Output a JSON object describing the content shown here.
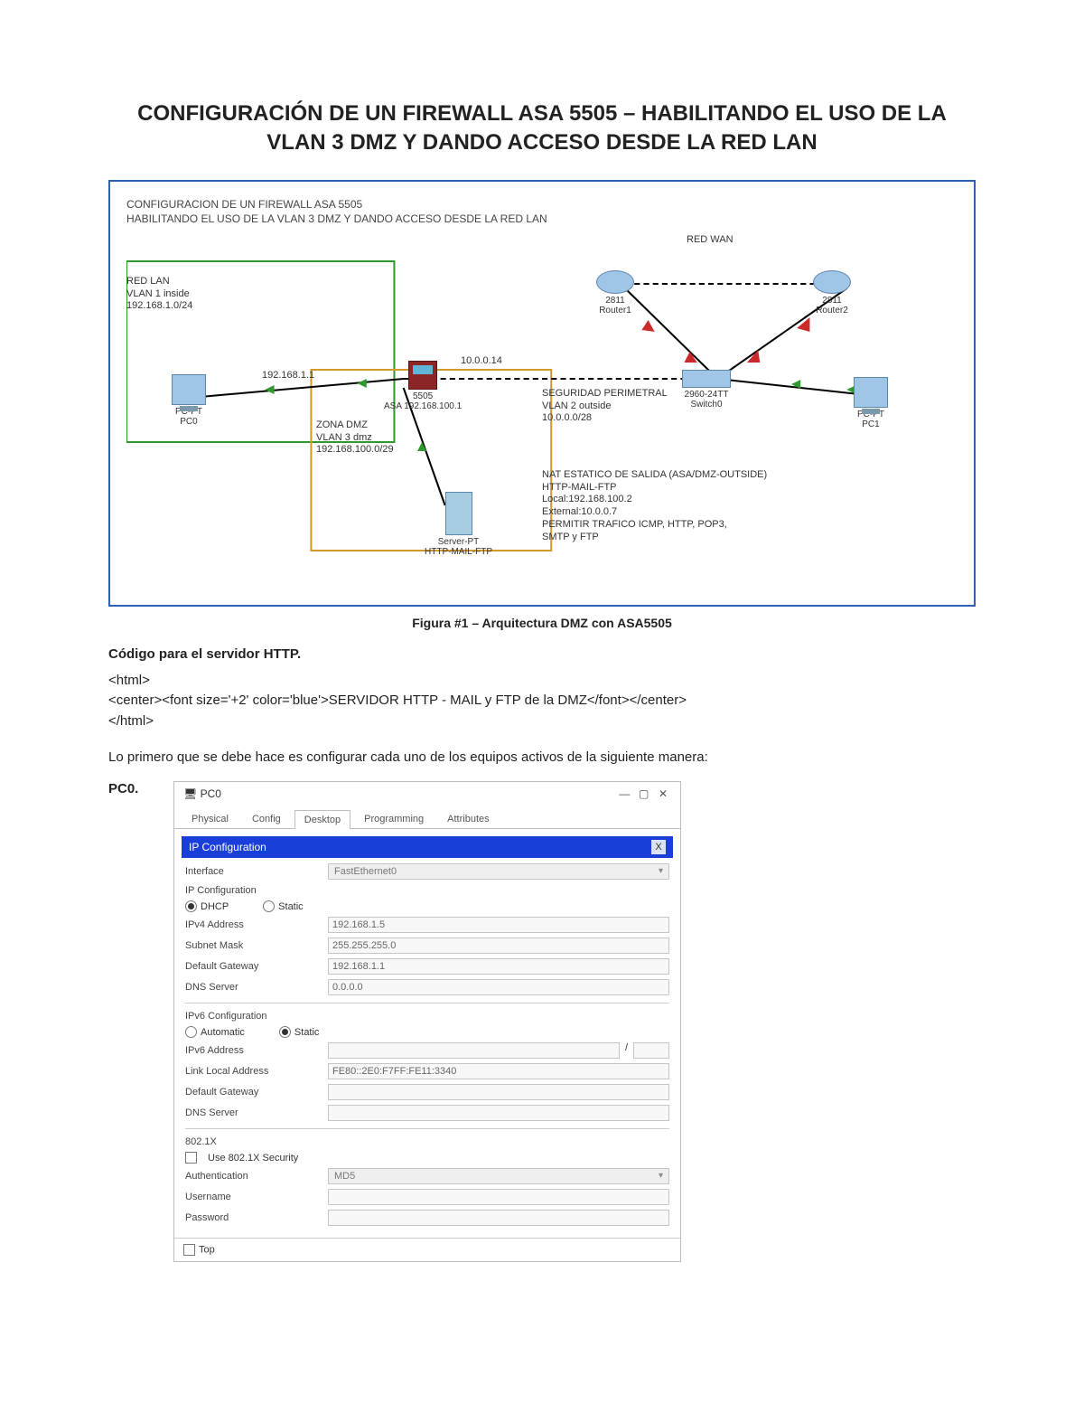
{
  "title": "CONFIGURACIÓN DE UN FIREWALL ASA 5505 – HABILITANDO EL USO DE LA VLAN 3 DMZ Y DANDO ACCESO DESDE LA RED LAN",
  "figure": {
    "line1": "CONFIGURACION DE UN FIREWALL ASA 5505",
    "line2": "HABILITANDO EL USO DE LA VLAN 3 DMZ Y DANDO ACCESO DESDE LA RED LAN",
    "red_wan": "RED WAN",
    "red_lan": {
      "l1": "RED LAN",
      "l2": "VLAN 1 inside",
      "l3": "192.168.1.0/24"
    },
    "zona_dmz": {
      "l1": "ZONA DMZ",
      "l2": "VLAN 3 dmz",
      "l3": "192.168.100.0/29"
    },
    "seguridad": {
      "l1": "SEGURIDAD PERIMETRAL",
      "l2": "VLAN 2 outside",
      "l3": "10.0.0.0/28"
    },
    "nat": {
      "l1": "NAT ESTATICO DE SALIDA (ASA/DMZ-OUTSIDE)",
      "l2": "HTTP-MAIL-FTP",
      "l3": "Local:192.168.100.2",
      "l4": "External:10.0.0.7",
      "l5": "PERMITIR TRAFICO ICMP, HTTP, POP3,",
      "l6": "SMTP y FTP"
    },
    "ips": {
      "lan_link": "192.168.1.1",
      "wan_link": "10.0.0.14"
    },
    "devices": {
      "pc0": {
        "l1": "PC-PT",
        "l2": "PC0"
      },
      "pc1": {
        "l1": "PC-PT",
        "l2": "PC1"
      },
      "asa": {
        "l1": "5505",
        "l2": "ASA 192.168.100.1"
      },
      "r1": {
        "l1": "2811",
        "l2": "Router1"
      },
      "r2": {
        "l1": "2811",
        "l2": "Router2"
      },
      "sw": {
        "l1": "2960-24TT",
        "l2": "Switch0"
      },
      "srv": {
        "l1": "Server-PT",
        "l2": "HTTP-MAIL-FTP"
      }
    }
  },
  "caption": "Figura #1 – Arquitectura DMZ con ASA5505",
  "section_http": "Código para el servidor HTTP.",
  "code": {
    "l1": "<html>",
    "l2": "<center><font size='+2' color='blue'>SERVIDOR HTTP - MAIL y FTP de la DMZ</font></center>",
    "l3": "</html>"
  },
  "intro": "Lo primero que se debe hace es configurar cada uno de los equipos activos de la siguiente manera:",
  "pc0_label": "PC0.",
  "dialog": {
    "title": "PC0",
    "tabs": [
      "Physical",
      "Config",
      "Desktop",
      "Programming",
      "Attributes"
    ],
    "active_tab": "Desktop",
    "bluebar": "IP Configuration",
    "interface_label": "Interface",
    "interface_value": "FastEthernet0",
    "ip_section": "IP Configuration",
    "dhcp": "DHCP",
    "static": "Static",
    "ipv4": {
      "k": "IPv4 Address",
      "v": "192.168.1.5"
    },
    "mask": {
      "k": "Subnet Mask",
      "v": "255.255.255.0"
    },
    "gw": {
      "k": "Default Gateway",
      "v": "192.168.1.1"
    },
    "dns": {
      "k": "DNS Server",
      "v": "0.0.0.0"
    },
    "ipv6_section": "IPv6 Configuration",
    "auto": "Automatic",
    "static6": "Static",
    "ipv6addr": {
      "k": "IPv6 Address",
      "v": "",
      "prefix": "/"
    },
    "ll": {
      "k": "Link Local Address",
      "v": "FE80::2E0:F7FF:FE11:3340"
    },
    "gw6": {
      "k": "Default Gateway",
      "v": ""
    },
    "dns6": {
      "k": "DNS Server",
      "v": ""
    },
    "sec_section": "802.1X",
    "use_sec": "Use 802.1X Security",
    "auth": {
      "k": "Authentication",
      "v": "MD5"
    },
    "user": {
      "k": "Username",
      "v": ""
    },
    "pass": {
      "k": "Password",
      "v": ""
    },
    "footer": "Top"
  }
}
